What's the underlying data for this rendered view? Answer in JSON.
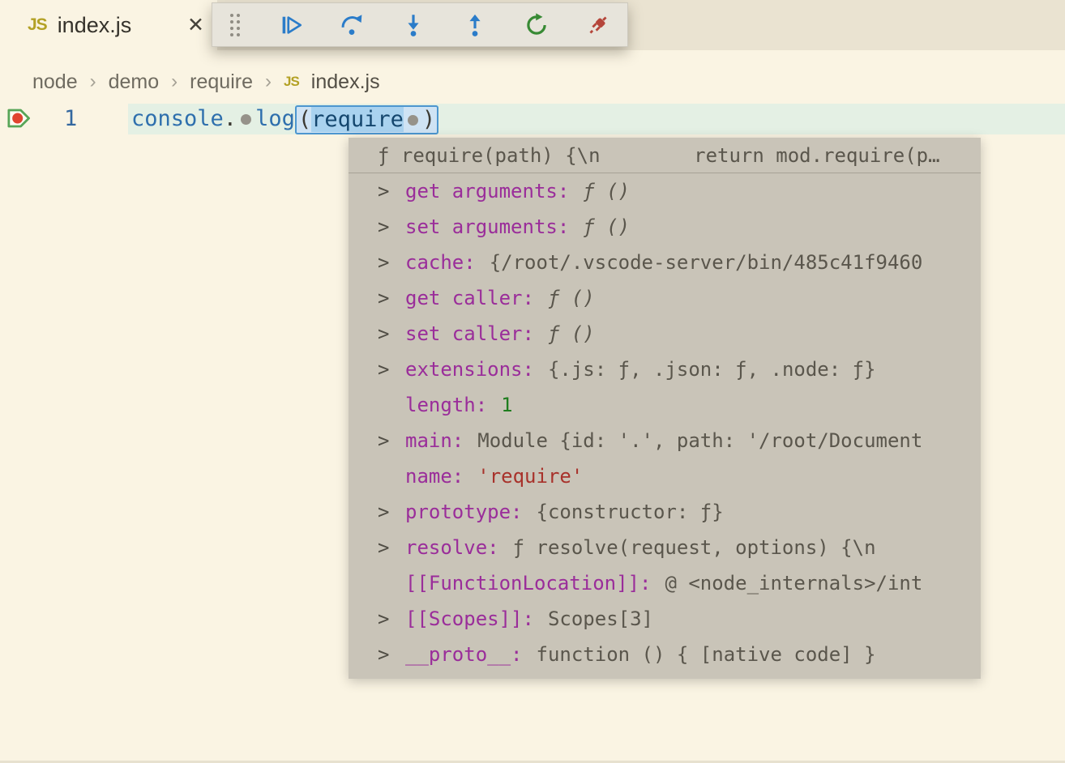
{
  "tab": {
    "js_badge": "JS",
    "label": "index.js",
    "close_glyph": "✕"
  },
  "toolbar": {
    "buttons": [
      {
        "id": "drag-handle"
      },
      {
        "id": "continue"
      },
      {
        "id": "step-over"
      },
      {
        "id": "step-into"
      },
      {
        "id": "step-out"
      },
      {
        "id": "restart"
      },
      {
        "id": "disconnect"
      }
    ]
  },
  "breadcrumb": {
    "separator": "›",
    "items": [
      "node",
      "demo",
      "require"
    ],
    "file_badge": "JS",
    "file": "index.js"
  },
  "editor": {
    "line_number": "1",
    "code": {
      "obj": "console",
      "dot": ".",
      "method": "log",
      "open_paren": "(",
      "arg": "require",
      "close_paren": ")"
    }
  },
  "popup": {
    "header": "ƒ require(path) {\\n        return mod.require(p…",
    "rows": [
      {
        "chevron": ">",
        "name": "get arguments:",
        "value": "ƒ ()"
      },
      {
        "chevron": ">",
        "name": "set arguments:",
        "value": "ƒ ()"
      },
      {
        "chevron": ">",
        "name": "cache:",
        "value": "{/root/.vscode-server/bin/485c41f9460"
      },
      {
        "chevron": ">",
        "name": "get caller:",
        "value": "ƒ ()"
      },
      {
        "chevron": ">",
        "name": "set caller:",
        "value": "ƒ ()"
      },
      {
        "chevron": ">",
        "name": "extensions:",
        "value": "{.js: ƒ, .json: ƒ, .node: ƒ}"
      },
      {
        "chevron": "",
        "name": "length:",
        "value": "1"
      },
      {
        "chevron": ">",
        "name": "main:",
        "value": "Module {id: '.', path: '/root/Document"
      },
      {
        "chevron": "",
        "name": "name:",
        "value": "'require'"
      },
      {
        "chevron": ">",
        "name": "prototype:",
        "value": "{constructor: ƒ}"
      },
      {
        "chevron": ">",
        "name": "resolve:",
        "value": "ƒ resolve(request, options) {\\n"
      },
      {
        "chevron": "",
        "name": "[[FunctionLocation]]:",
        "value": "@ <node_internals>/int"
      },
      {
        "chevron": ">",
        "name": "[[Scopes]]:",
        "value": "Scopes[3]"
      },
      {
        "chevron": ">",
        "name": "__proto__:",
        "value": "function () { [native code] }"
      }
    ]
  },
  "icons": {
    "js-badge": "JS",
    "close": "✕",
    "drag-handle": "dot-grid",
    "continue": "bar-play-triangle",
    "step-over": "curved-arrow-over-dot",
    "step-into": "arrow-down-to-dot",
    "step-out": "arrow-up-from-dot",
    "restart": "circular-arrow",
    "disconnect": "plug",
    "breakpoint-current-line": "arrow-outline-with-red-dot",
    "inline-breakpoint": "●",
    "expand-chevron": ">"
  },
  "colors": {
    "background": "#faf4e3",
    "tabstrip": "#eae3d1",
    "toolbar_bg": "#e7e4db",
    "accent_blue": "#2b7cc9",
    "restart_green": "#388a34",
    "disconnect_red": "#b5453a",
    "line_highlight": "#e4f0e4",
    "selection_blue": "#a9d2ef",
    "popup_bg": "#c9c4b8",
    "property_purple": "#9a2d9a",
    "value_gray": "#5a564c",
    "number_green": "#1e7d1e",
    "string_red": "#a8322b",
    "breakpoint_red": "#e0442f",
    "breakpoint_arrow_green": "#57a557",
    "js_badge_yellow": "#b3a125"
  }
}
